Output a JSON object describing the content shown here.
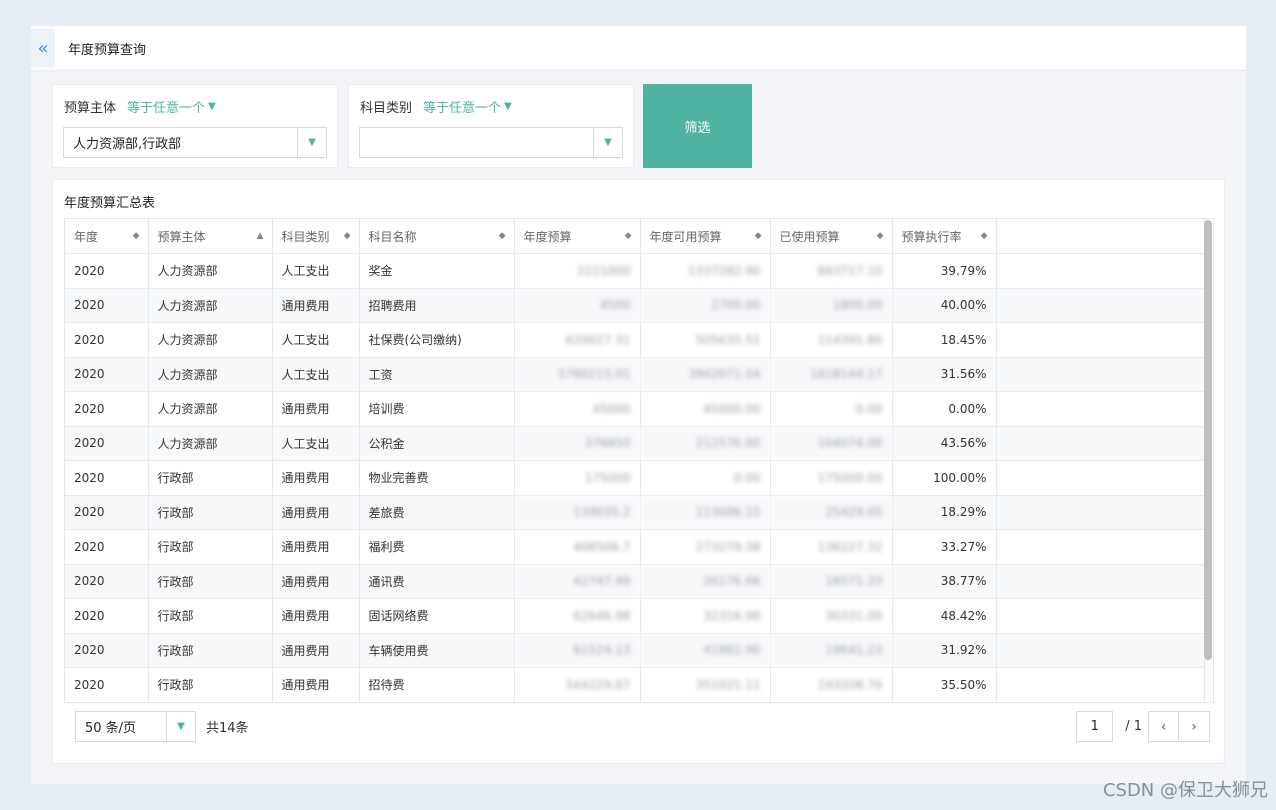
{
  "header": {
    "back_glyph": "«",
    "title": "年度预算查询"
  },
  "filters": [
    {
      "label": "预算主体",
      "operator": "等于任意一个",
      "value": "人力资源部,行政部"
    },
    {
      "label": "科目类别",
      "operator": "等于任意一个",
      "value": ""
    }
  ],
  "filter_button": "筛选",
  "table": {
    "title": "年度预算汇总表",
    "columns": [
      "年度",
      "预算主体",
      "科目类别",
      "科目名称",
      "年度预算",
      "年度可用预算",
      "已使用预算",
      "预算执行率"
    ],
    "rows": [
      [
        "2020",
        "人力资源部",
        "人工支出",
        "奖金",
        "2221000",
        "1337282.90",
        "883717.10",
        "39.79%"
      ],
      [
        "2020",
        "人力资源部",
        "通用费用",
        "招聘费用",
        "4500",
        "2700.00",
        "1800.00",
        "40.00%"
      ],
      [
        "2020",
        "人力资源部",
        "人工支出",
        "社保费(公司缴纳)",
        "620027.31",
        "505635.51",
        "114391.80",
        "18.45%"
      ],
      [
        "2020",
        "人力资源部",
        "人工支出",
        "工资",
        "5760215.01",
        "3942071.04",
        "1818144.17",
        "31.56%"
      ],
      [
        "2020",
        "人力资源部",
        "通用费用",
        "培训费",
        "45000",
        "45000.00",
        "0.00",
        "0.00%"
      ],
      [
        "2020",
        "人力资源部",
        "人工支出",
        "公积金",
        "376650",
        "212576.00",
        "164074.00",
        "43.56%"
      ],
      [
        "2020",
        "行政部",
        "通用费用",
        "物业完善费",
        "175000",
        "0.00",
        "175000.00",
        "100.00%"
      ],
      [
        "2020",
        "行政部",
        "通用费用",
        "差旅费",
        "139035.2",
        "113006.15",
        "25429.05",
        "18.29%"
      ],
      [
        "2020",
        "行政部",
        "通用费用",
        "福利费",
        "408506.7",
        "273279.38",
        "136227.32",
        "33.27%"
      ],
      [
        "2020",
        "行政部",
        "通用费用",
        "通讯费",
        "42747.99",
        "26176.66",
        "16571.33",
        "38.77%"
      ],
      [
        "2020",
        "行政部",
        "通用费用",
        "固话网络费",
        "62646.98",
        "32316.98",
        "30331.00",
        "48.42%"
      ],
      [
        "2020",
        "行政部",
        "通用费用",
        "车辆使用费",
        "61524.13",
        "41882.90",
        "19641.23",
        "31.92%"
      ],
      [
        "2020",
        "行政部",
        "通用费用",
        "招待费",
        "544229.87",
        "351021.11",
        "193208.76",
        "35.50%"
      ]
    ]
  },
  "pagination": {
    "page_size": "50 条/页",
    "total": "共14条",
    "current_page": "1",
    "page_total": "/ 1",
    "prev_glyph": "‹",
    "next_glyph": "›"
  },
  "watermark": "CSDN @保卫大狮兄",
  "colors": {
    "accent": "#4fb3a2",
    "link": "#4ab3a1",
    "background": "#e6edf5"
  }
}
